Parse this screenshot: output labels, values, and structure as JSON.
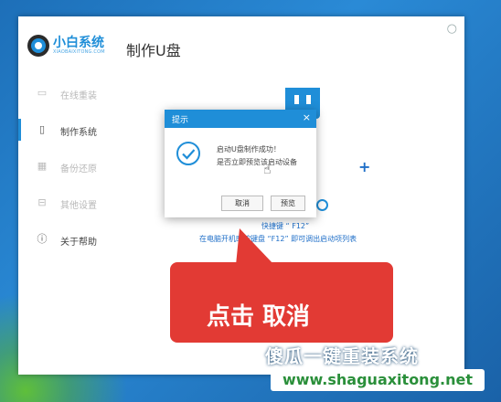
{
  "app": {
    "brand": "小白系统",
    "brand_sub": "XIAOBAIXITONG.COM",
    "page_title": "制作U盘",
    "close_glyph": "○"
  },
  "sidebar": {
    "items": [
      {
        "label": "在线重装",
        "icon": "monitor-icon",
        "active": false
      },
      {
        "label": "制作系统",
        "icon": "usb-icon",
        "active": true
      },
      {
        "label": "备份还原",
        "icon": "backup-icon",
        "active": false
      },
      {
        "label": "其他设置",
        "icon": "toolbox-icon",
        "active": false
      },
      {
        "label": "关于帮助",
        "icon": "info-icon",
        "active": false
      }
    ]
  },
  "content": {
    "plus": "+",
    "hint_line1": "快捷键 “ F12”",
    "hint_line2": "在电脑开机时按键盘 “F12” 即可调出启动项列表",
    "accent_color": "#1f8ed8"
  },
  "dialog": {
    "title": "提示",
    "close": "×",
    "message_line1": "启动U盘制作成功！",
    "message_line2": "是否立即预览该启动设备",
    "cancel_label": "取消",
    "preview_label": "预览"
  },
  "callout": {
    "text": "点击 取消",
    "color": "#e23a34"
  },
  "watermark": {
    "title": "傻瓜一键重装系统",
    "url": "www.shaguaxitong.net"
  }
}
